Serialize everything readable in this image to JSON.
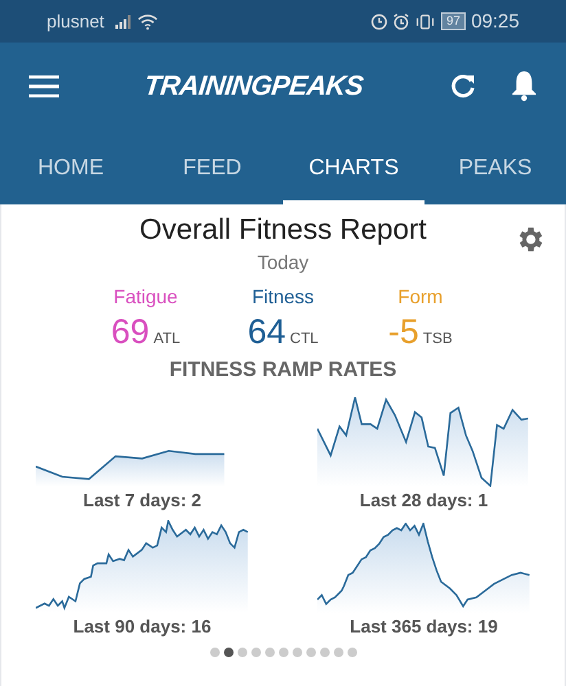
{
  "status_bar": {
    "carrier": "plusnet",
    "battery": "97",
    "time": "09:25"
  },
  "app_bar": {
    "logo": "TRAININGPEAKS"
  },
  "tabs": [
    {
      "label": "HOME",
      "selected": false
    },
    {
      "label": "FEED",
      "selected": false
    },
    {
      "label": "CHARTS",
      "selected": true
    },
    {
      "label": "PEAKS",
      "selected": false
    }
  ],
  "report": {
    "title": "Overall Fitness Report",
    "subtitle": "Today",
    "metrics": [
      {
        "label": "Fatigue",
        "value": "69",
        "unit": "ATL",
        "color": "#d94fbf"
      },
      {
        "label": "Fitness",
        "value": "64",
        "unit": "CTL",
        "color": "#1f5f95"
      },
      {
        "label": "Form",
        "value": "-5",
        "unit": "TSB",
        "color": "#e8a02c"
      }
    ],
    "section_title": "FITNESS RAMP RATES",
    "ramp_rates": [
      {
        "label": "Last 7 days: 2"
      },
      {
        "label": "Last 28 days: 1"
      },
      {
        "label": "Last 90 days: 16"
      },
      {
        "label": "Last 365 days: 19"
      }
    ]
  },
  "pager": [
    {
      "selected": false
    },
    {
      "selected": true
    },
    {
      "selected": false
    },
    {
      "selected": false
    },
    {
      "selected": false
    },
    {
      "selected": false
    },
    {
      "selected": false
    },
    {
      "selected": false
    },
    {
      "selected": false
    },
    {
      "selected": false
    },
    {
      "selected": false
    }
  ]
}
